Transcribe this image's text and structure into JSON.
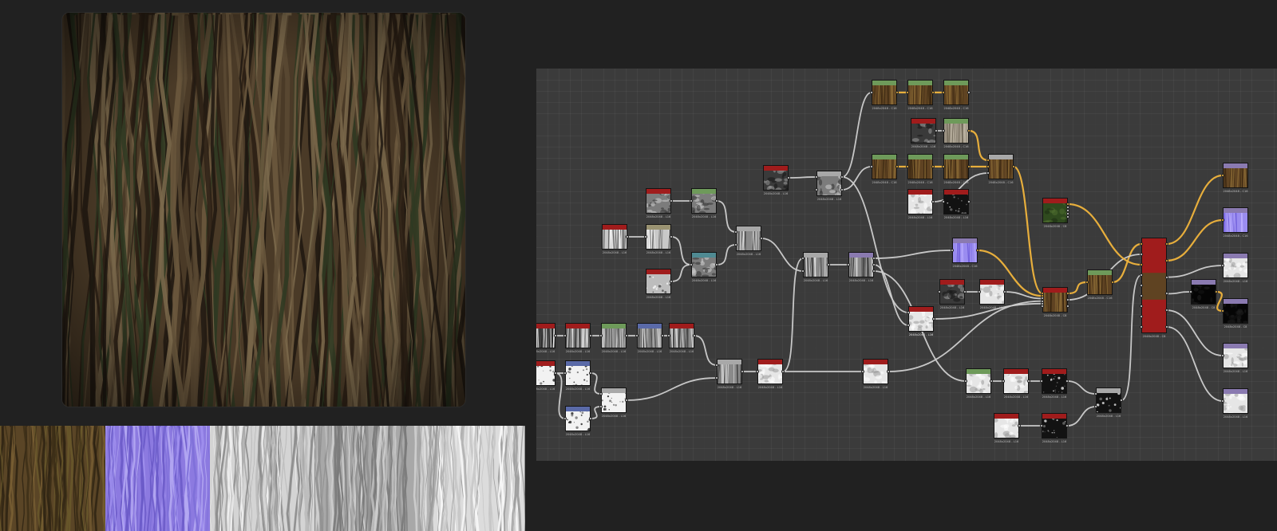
{
  "colors": {
    "background": "#212121",
    "graph_bg": "#3b3b3b",
    "wire_gray": "#cfcfcf",
    "wire_yellow": "#f0b43c",
    "header_red": "#a01c1c",
    "header_green": "#6e9a5a",
    "header_blue": "#5a6aa8",
    "header_violet": "#8a7ab0"
  },
  "preview": {
    "icon": "bark-material-sphere-icon"
  },
  "swatches": [
    {
      "name": "basecolor"
    },
    {
      "name": "normal"
    },
    {
      "name": "roughness"
    },
    {
      "name": "height"
    },
    {
      "name": "ambient-occlusion"
    }
  ],
  "graph": {
    "nodes": [
      {
        "label": "2048x2048 - L16",
        "header": "red",
        "thumb": "streak-dark"
      },
      {
        "label": "2048x2048 - L16",
        "header": "red",
        "thumb": "streak-gray"
      },
      {
        "label": "2048x2048 - L16",
        "header": "green",
        "thumb": "streak-gray"
      },
      {
        "label": "2048x2048 - L16",
        "header": "blue",
        "thumb": "streak-gray"
      },
      {
        "label": "2048x2048 - L16",
        "header": "red",
        "thumb": "streak-gray"
      },
      {
        "label": "2048x2048 - L16",
        "header": "red",
        "thumb": "speckle-white"
      },
      {
        "label": "2048x2048 - L16",
        "header": "blue",
        "thumb": "speckle-white"
      },
      {
        "label": "2048x2048 - L16",
        "header": "blue",
        "thumb": "speckle-white"
      },
      {
        "label": "2048x2048 - L16",
        "header": "gray",
        "thumb": "speckle-white"
      },
      {
        "label": "2048x2048 - L16",
        "header": "red",
        "thumb": "streak-light"
      },
      {
        "label": "2048x2048 - L16",
        "header": "tan",
        "thumb": "streak-light"
      },
      {
        "label": "2048x2048 - L16",
        "header": "red",
        "thumb": "noise-gray"
      },
      {
        "label": "2048x2048 - L16",
        "header": "green",
        "thumb": "noise-gray"
      },
      {
        "label": "2048x2048 - L16",
        "header": "teal",
        "thumb": "noise-gray"
      },
      {
        "label": "2048x2048 - L16",
        "header": "red",
        "thumb": "cells-gray"
      },
      {
        "label": "2048x2048 - L16",
        "header": "gray",
        "thumb": "streak-gray"
      },
      {
        "label": "2048x2048 - L16",
        "header": "gray",
        "thumb": "streak-gray"
      },
      {
        "label": "2048x2048 - L16",
        "header": "red",
        "thumb": "noise-white"
      },
      {
        "label": "2048x2048 - L16",
        "header": "red",
        "thumb": "noise-dark"
      },
      {
        "label": "2048x2048 - L16",
        "header": "gray",
        "thumb": "noise-gray"
      },
      {
        "label": "2048x2048 - L16",
        "header": "gray",
        "thumb": "streak-gray"
      },
      {
        "label": "2048x2048 - L16",
        "header": "violet",
        "thumb": "streak-gray"
      },
      {
        "label": "2048x2048 - L16",
        "header": "red",
        "thumb": "noise-white"
      },
      {
        "label": "2048x2048 - L16",
        "header": "red",
        "thumb": "noise-white"
      },
      {
        "label": "2048x2048 - C16",
        "header": "green",
        "thumb": "bark-color"
      },
      {
        "label": "2048x2048 - C16",
        "header": "green",
        "thumb": "bark-color"
      },
      {
        "label": "2048x2048 - C16",
        "header": "green",
        "thumb": "bark-color"
      },
      {
        "label": "2048x2048 - L16",
        "header": "red",
        "thumb": "noise-dark"
      },
      {
        "label": "2048x2048 - C16",
        "header": "green",
        "thumb": "bark-gray"
      },
      {
        "label": "2048x2048 - C16",
        "header": "green",
        "thumb": "bark-color"
      },
      {
        "label": "2048x2048 - C16",
        "header": "green",
        "thumb": "bark-color"
      },
      {
        "label": "2048x2048 - C16",
        "header": "green",
        "thumb": "bark-color"
      },
      {
        "label": "2048x2048 - C16",
        "header": "gray",
        "thumb": "bark-color"
      },
      {
        "label": "2048x2048 - L16",
        "header": "red",
        "thumb": "noise-white"
      },
      {
        "label": "2048x2048 - L16",
        "header": "red",
        "thumb": "cells-black"
      },
      {
        "label": "2048x2048 - C8",
        "header": "red",
        "thumb": "green-moss"
      },
      {
        "label": "2048x2048 - C16",
        "header": "violet",
        "thumb": "normal"
      },
      {
        "label": "2048x2048 - L16",
        "header": "red",
        "thumb": "noise-dark"
      },
      {
        "label": "2048x2048 - L16",
        "header": "red",
        "thumb": "noise-white"
      },
      {
        "label": "2048x2048 - L16",
        "header": "red",
        "thumb": "noise-white"
      },
      {
        "label": "2048x2048 - C8",
        "header": "red",
        "thumb": "bark-color"
      },
      {
        "label": "2048x2048 - C16",
        "header": "green",
        "thumb": "bark-color"
      },
      {
        "label": "2048x2048 - L16",
        "header": "green",
        "thumb": "noise-white"
      },
      {
        "label": "2048x2048 - L16",
        "header": "red",
        "thumb": "noise-white"
      },
      {
        "label": "2048x2048 - L16",
        "header": "red",
        "thumb": "cells-black"
      },
      {
        "label": "2048x2048 - L16",
        "header": "gray",
        "thumb": "cells-black"
      },
      {
        "label": "2048x2048 - L16",
        "header": "red",
        "thumb": "noise-white"
      },
      {
        "label": "2048x2048 - L16",
        "header": "red",
        "thumb": "cells-black"
      },
      {
        "label": "2048x2048 - C8",
        "header": "red",
        "thumb": "bark-color"
      },
      {
        "label": "2048x2048 - C8",
        "header": "violet",
        "thumb": "black"
      },
      {
        "label": "2048x2048 - C16",
        "header": "violet",
        "thumb": "bark-color"
      },
      {
        "label": "2048x2048 - C16",
        "header": "violet",
        "thumb": "normal"
      },
      {
        "label": "2048x2048 - L16",
        "header": "violet",
        "thumb": "noise-white"
      },
      {
        "label": "2048x2048 - C8",
        "header": "violet",
        "thumb": "black"
      },
      {
        "label": "2048x2048 - L16",
        "header": "violet",
        "thumb": "noise-white"
      },
      {
        "label": "2048x2048 - L16",
        "header": "violet",
        "thumb": "noise-white"
      }
    ]
  }
}
